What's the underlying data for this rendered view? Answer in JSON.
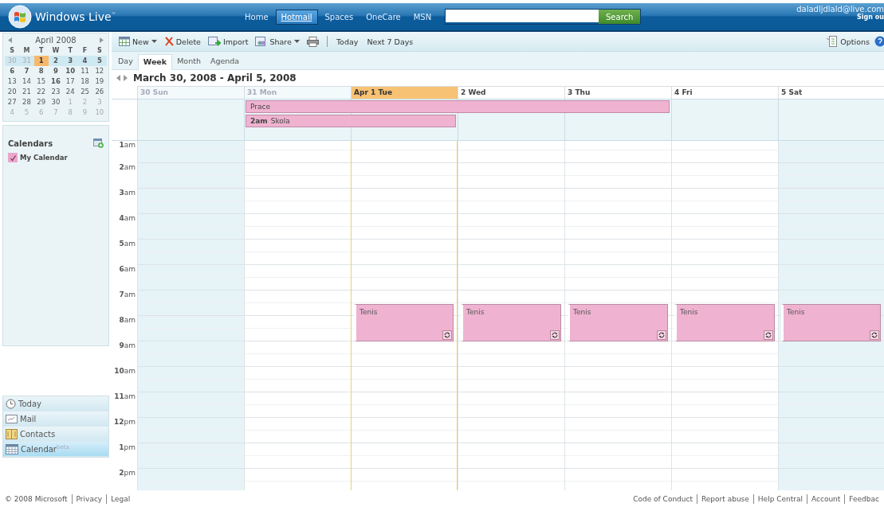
{
  "header": {
    "brand": "Windows Live",
    "brand_mark": "™",
    "nav": [
      {
        "label": "Home",
        "selected": false
      },
      {
        "label": "Hotmail",
        "selected": true
      },
      {
        "label": "Spaces",
        "selected": false
      },
      {
        "label": "OneCare",
        "selected": false
      },
      {
        "label": "MSN",
        "selected": false
      }
    ],
    "search": {
      "button": "Search"
    },
    "account": {
      "email": "daladljdlald@live.com",
      "sign_out": "Sign ou"
    }
  },
  "mini_calendar": {
    "title": "April 2008",
    "weekdays": [
      "S",
      "M",
      "T",
      "W",
      "T",
      "F",
      "S"
    ],
    "weeks": [
      {
        "selected": true,
        "days": [
          {
            "d": "30",
            "muted": true,
            "bold": false,
            "today": false
          },
          {
            "d": "31",
            "muted": true,
            "bold": false,
            "today": false
          },
          {
            "d": "1",
            "muted": false,
            "bold": true,
            "today": true
          },
          {
            "d": "2",
            "muted": false,
            "bold": true,
            "today": false
          },
          {
            "d": "3",
            "muted": false,
            "bold": true,
            "today": false
          },
          {
            "d": "4",
            "muted": false,
            "bold": true,
            "today": false
          },
          {
            "d": "5",
            "muted": false,
            "bold": true,
            "today": false
          }
        ]
      },
      {
        "selected": false,
        "days": [
          {
            "d": "6",
            "muted": false,
            "bold": true,
            "today": false
          },
          {
            "d": "7",
            "muted": false,
            "bold": true,
            "today": false
          },
          {
            "d": "8",
            "muted": false,
            "bold": true,
            "today": false
          },
          {
            "d": "9",
            "muted": false,
            "bold": true,
            "today": false
          },
          {
            "d": "10",
            "muted": false,
            "bold": true,
            "today": false
          },
          {
            "d": "11",
            "muted": false,
            "bold": false,
            "today": false
          },
          {
            "d": "12",
            "muted": false,
            "bold": false,
            "today": false
          }
        ]
      },
      {
        "selected": false,
        "days": [
          {
            "d": "13",
            "muted": false,
            "bold": false,
            "today": false
          },
          {
            "d": "14",
            "muted": false,
            "bold": false,
            "today": false
          },
          {
            "d": "15",
            "muted": false,
            "bold": false,
            "today": false
          },
          {
            "d": "16",
            "muted": false,
            "bold": true,
            "today": false
          },
          {
            "d": "17",
            "muted": false,
            "bold": false,
            "today": false
          },
          {
            "d": "18",
            "muted": false,
            "bold": false,
            "today": false
          },
          {
            "d": "19",
            "muted": false,
            "bold": false,
            "today": false
          }
        ]
      },
      {
        "selected": false,
        "days": [
          {
            "d": "20",
            "muted": false,
            "bold": false,
            "today": false
          },
          {
            "d": "21",
            "muted": false,
            "bold": false,
            "today": false
          },
          {
            "d": "22",
            "muted": false,
            "bold": false,
            "today": false
          },
          {
            "d": "23",
            "muted": false,
            "bold": false,
            "today": false
          },
          {
            "d": "24",
            "muted": false,
            "bold": false,
            "today": false
          },
          {
            "d": "25",
            "muted": false,
            "bold": false,
            "today": false
          },
          {
            "d": "26",
            "muted": false,
            "bold": false,
            "today": false
          }
        ]
      },
      {
        "selected": false,
        "days": [
          {
            "d": "27",
            "muted": false,
            "bold": false,
            "today": false
          },
          {
            "d": "28",
            "muted": false,
            "bold": false,
            "today": false
          },
          {
            "d": "29",
            "muted": false,
            "bold": false,
            "today": false
          },
          {
            "d": "30",
            "muted": false,
            "bold": false,
            "today": false
          },
          {
            "d": "1",
            "muted": true,
            "bold": false,
            "today": false
          },
          {
            "d": "2",
            "muted": true,
            "bold": false,
            "today": false
          },
          {
            "d": "3",
            "muted": true,
            "bold": false,
            "today": false
          }
        ]
      },
      {
        "selected": false,
        "days": [
          {
            "d": "4",
            "muted": true,
            "bold": false,
            "today": false
          },
          {
            "d": "5",
            "muted": true,
            "bold": false,
            "today": false
          },
          {
            "d": "6",
            "muted": true,
            "bold": false,
            "today": false
          },
          {
            "d": "7",
            "muted": true,
            "bold": false,
            "today": false
          },
          {
            "d": "8",
            "muted": true,
            "bold": false,
            "today": false
          },
          {
            "d": "9",
            "muted": true,
            "bold": false,
            "today": false
          },
          {
            "d": "10",
            "muted": true,
            "bold": false,
            "today": false
          }
        ]
      }
    ]
  },
  "calendars": {
    "title": "Calendars",
    "items": [
      {
        "name": "My Calendar",
        "checked": true,
        "color": "#e8a8cc"
      }
    ]
  },
  "nav": [
    {
      "kind": "clock",
      "label": "Today",
      "selected": false
    },
    {
      "kind": "mail",
      "label": "Mail",
      "selected": false
    },
    {
      "kind": "contacts",
      "label": "Contacts",
      "selected": false
    },
    {
      "kind": "calendar",
      "label": "Calendar",
      "badge": "beta",
      "selected": true
    }
  ],
  "toolbar": {
    "items": [
      {
        "kind": "new",
        "label": "New",
        "menu": true
      },
      {
        "kind": "delete",
        "label": "Delete",
        "menu": false
      },
      {
        "kind": "import",
        "label": "Import",
        "menu": false
      },
      {
        "kind": "share",
        "label": "Share",
        "menu": true
      },
      {
        "kind": "print",
        "menu": false
      }
    ],
    "links": [
      "Today",
      "Next 7 Days"
    ],
    "options": "Options"
  },
  "views": [
    {
      "label": "Day",
      "selected": false
    },
    {
      "label": "Week",
      "selected": true
    },
    {
      "label": "Month",
      "selected": false
    },
    {
      "label": "Agenda",
      "selected": false
    }
  ],
  "range": "March 30, 2008 - April 5, 2008",
  "days": [
    {
      "label": "30 Sun",
      "muted": true,
      "today": false,
      "weekend": true
    },
    {
      "label": "31 Mon",
      "muted": true,
      "today": false,
      "weekend": false
    },
    {
      "label": "Apr 1 Tue",
      "muted": false,
      "today": true,
      "weekend": false,
      "events": [
        {
          "title": "Tenis",
          "recurring": true
        }
      ]
    },
    {
      "label": "2 Wed",
      "muted": false,
      "today": false,
      "weekend": false,
      "events": [
        {
          "title": "Tenis",
          "recurring": true
        }
      ]
    },
    {
      "label": "3 Thu",
      "muted": false,
      "today": false,
      "weekend": false,
      "events": [
        {
          "title": "Tenis",
          "recurring": true
        }
      ]
    },
    {
      "label": "4 Fri",
      "muted": false,
      "today": false,
      "weekend": false,
      "events": [
        {
          "title": "Tenis",
          "recurring": true
        }
      ]
    },
    {
      "label": "5 Sat",
      "muted": false,
      "today": false,
      "weekend": true,
      "events": [
        {
          "title": "Tenis",
          "recurring": true
        }
      ]
    }
  ],
  "all_day": [
    {
      "title": "Prace"
    },
    {
      "time": "2am",
      "title": "Skola"
    }
  ],
  "hours": [
    "**1**am",
    "**2**am",
    "**3**am",
    "**4**am",
    "**5**am",
    "**6**am",
    "**7**am",
    "**8**am",
    "**9**am",
    "**10**am",
    "**11**am",
    "**12**pm",
    "**1**pm",
    "**2**pm"
  ],
  "footer": {
    "left": [
      "© 2008 Microsoft",
      "Privacy",
      "Legal"
    ],
    "right": [
      "Code of Conduct",
      "Report abuse",
      "Help Central",
      "Account",
      "Feedbac"
    ]
  }
}
